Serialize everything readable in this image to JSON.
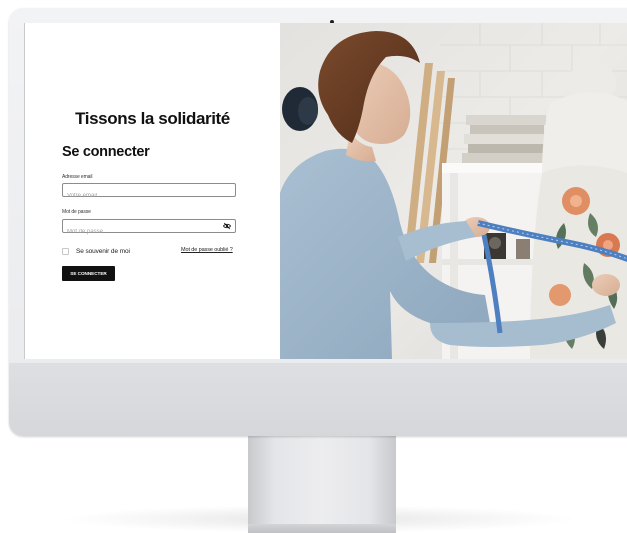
{
  "login": {
    "brand_title": "Tissons la solidarité",
    "heading": "Se connecter",
    "email": {
      "label": "Adresse email",
      "placeholder": "Votre email",
      "value": ""
    },
    "password": {
      "label": "Mot de passe",
      "placeholder": "Mot de passe",
      "value": ""
    },
    "remember_label": "Se souvenir de moi",
    "remember_checked": false,
    "forgot_link": "Mot de passe oublié ?",
    "submit_label": "SE CONNECTER"
  },
  "icons": {
    "password_toggle": "eye-slash-icon"
  },
  "colors": {
    "button_background": "#111111",
    "text_primary": "#111111",
    "field_border": "#8c8c8c",
    "monitor_body": "#e9eaed"
  }
}
